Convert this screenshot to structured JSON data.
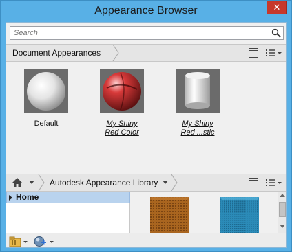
{
  "window": {
    "title": "Appearance Browser",
    "close_label": "✕"
  },
  "search": {
    "placeholder": "Search"
  },
  "document_section": {
    "breadcrumb": "Document Appearances",
    "items": [
      {
        "label": "Default"
      },
      {
        "label": "My Shiny Red Color"
      },
      {
        "label": "My Shiny Red ...stic"
      }
    ]
  },
  "library_section": {
    "breadcrumb": "Autodesk Appearance Library",
    "tree": {
      "home_label": "Home"
    }
  },
  "colors": {
    "title_bar": "#58b0e6",
    "close": "#c7382b",
    "tree_selection": "#b9d3ee"
  }
}
